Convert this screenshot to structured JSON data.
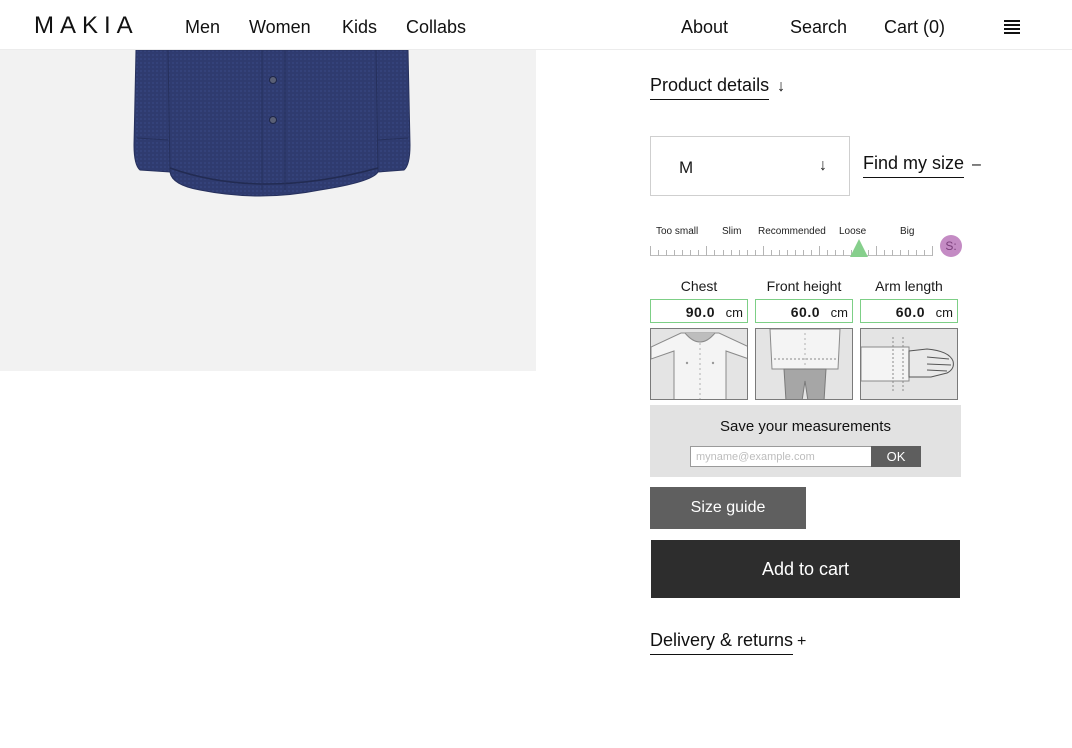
{
  "header": {
    "logo": "MAKIA",
    "nav": [
      "Men",
      "Women",
      "Kids",
      "Collabs"
    ],
    "about": "About",
    "search": "Search",
    "cart": "Cart (0)"
  },
  "product": {
    "details_label": "Product details",
    "details_icon": "↓",
    "size": {
      "selected": "M",
      "arrow": "↓"
    },
    "find_size": {
      "label": "Find my size",
      "icon": "–"
    },
    "fit_scale": {
      "labels": [
        "Too small",
        "Slim",
        "Recommended",
        "Loose",
        "Big"
      ],
      "badge": "S:"
    },
    "measurements": [
      {
        "label": "Chest",
        "value": "90.0",
        "unit": "cm"
      },
      {
        "label": "Front height",
        "value": "60.0",
        "unit": "cm"
      },
      {
        "label": "Arm length",
        "value": "60.0",
        "unit": "cm"
      }
    ],
    "save": {
      "title": "Save your measurements",
      "placeholder": "myname@example.com",
      "ok": "OK"
    },
    "size_guide": "Size guide",
    "add_to_cart": "Add to cart",
    "delivery": {
      "label": "Delivery & returns",
      "icon": "+"
    }
  },
  "colors": {
    "shirt": "#2e3a6e",
    "image_bg": "#f2f2f2",
    "fit_marker": "#86cf8c",
    "badge": "#c48bc4",
    "input_border": "#7dcf86",
    "button_dark": "#2d2d2d",
    "button_grey": "#5f5f5f"
  }
}
